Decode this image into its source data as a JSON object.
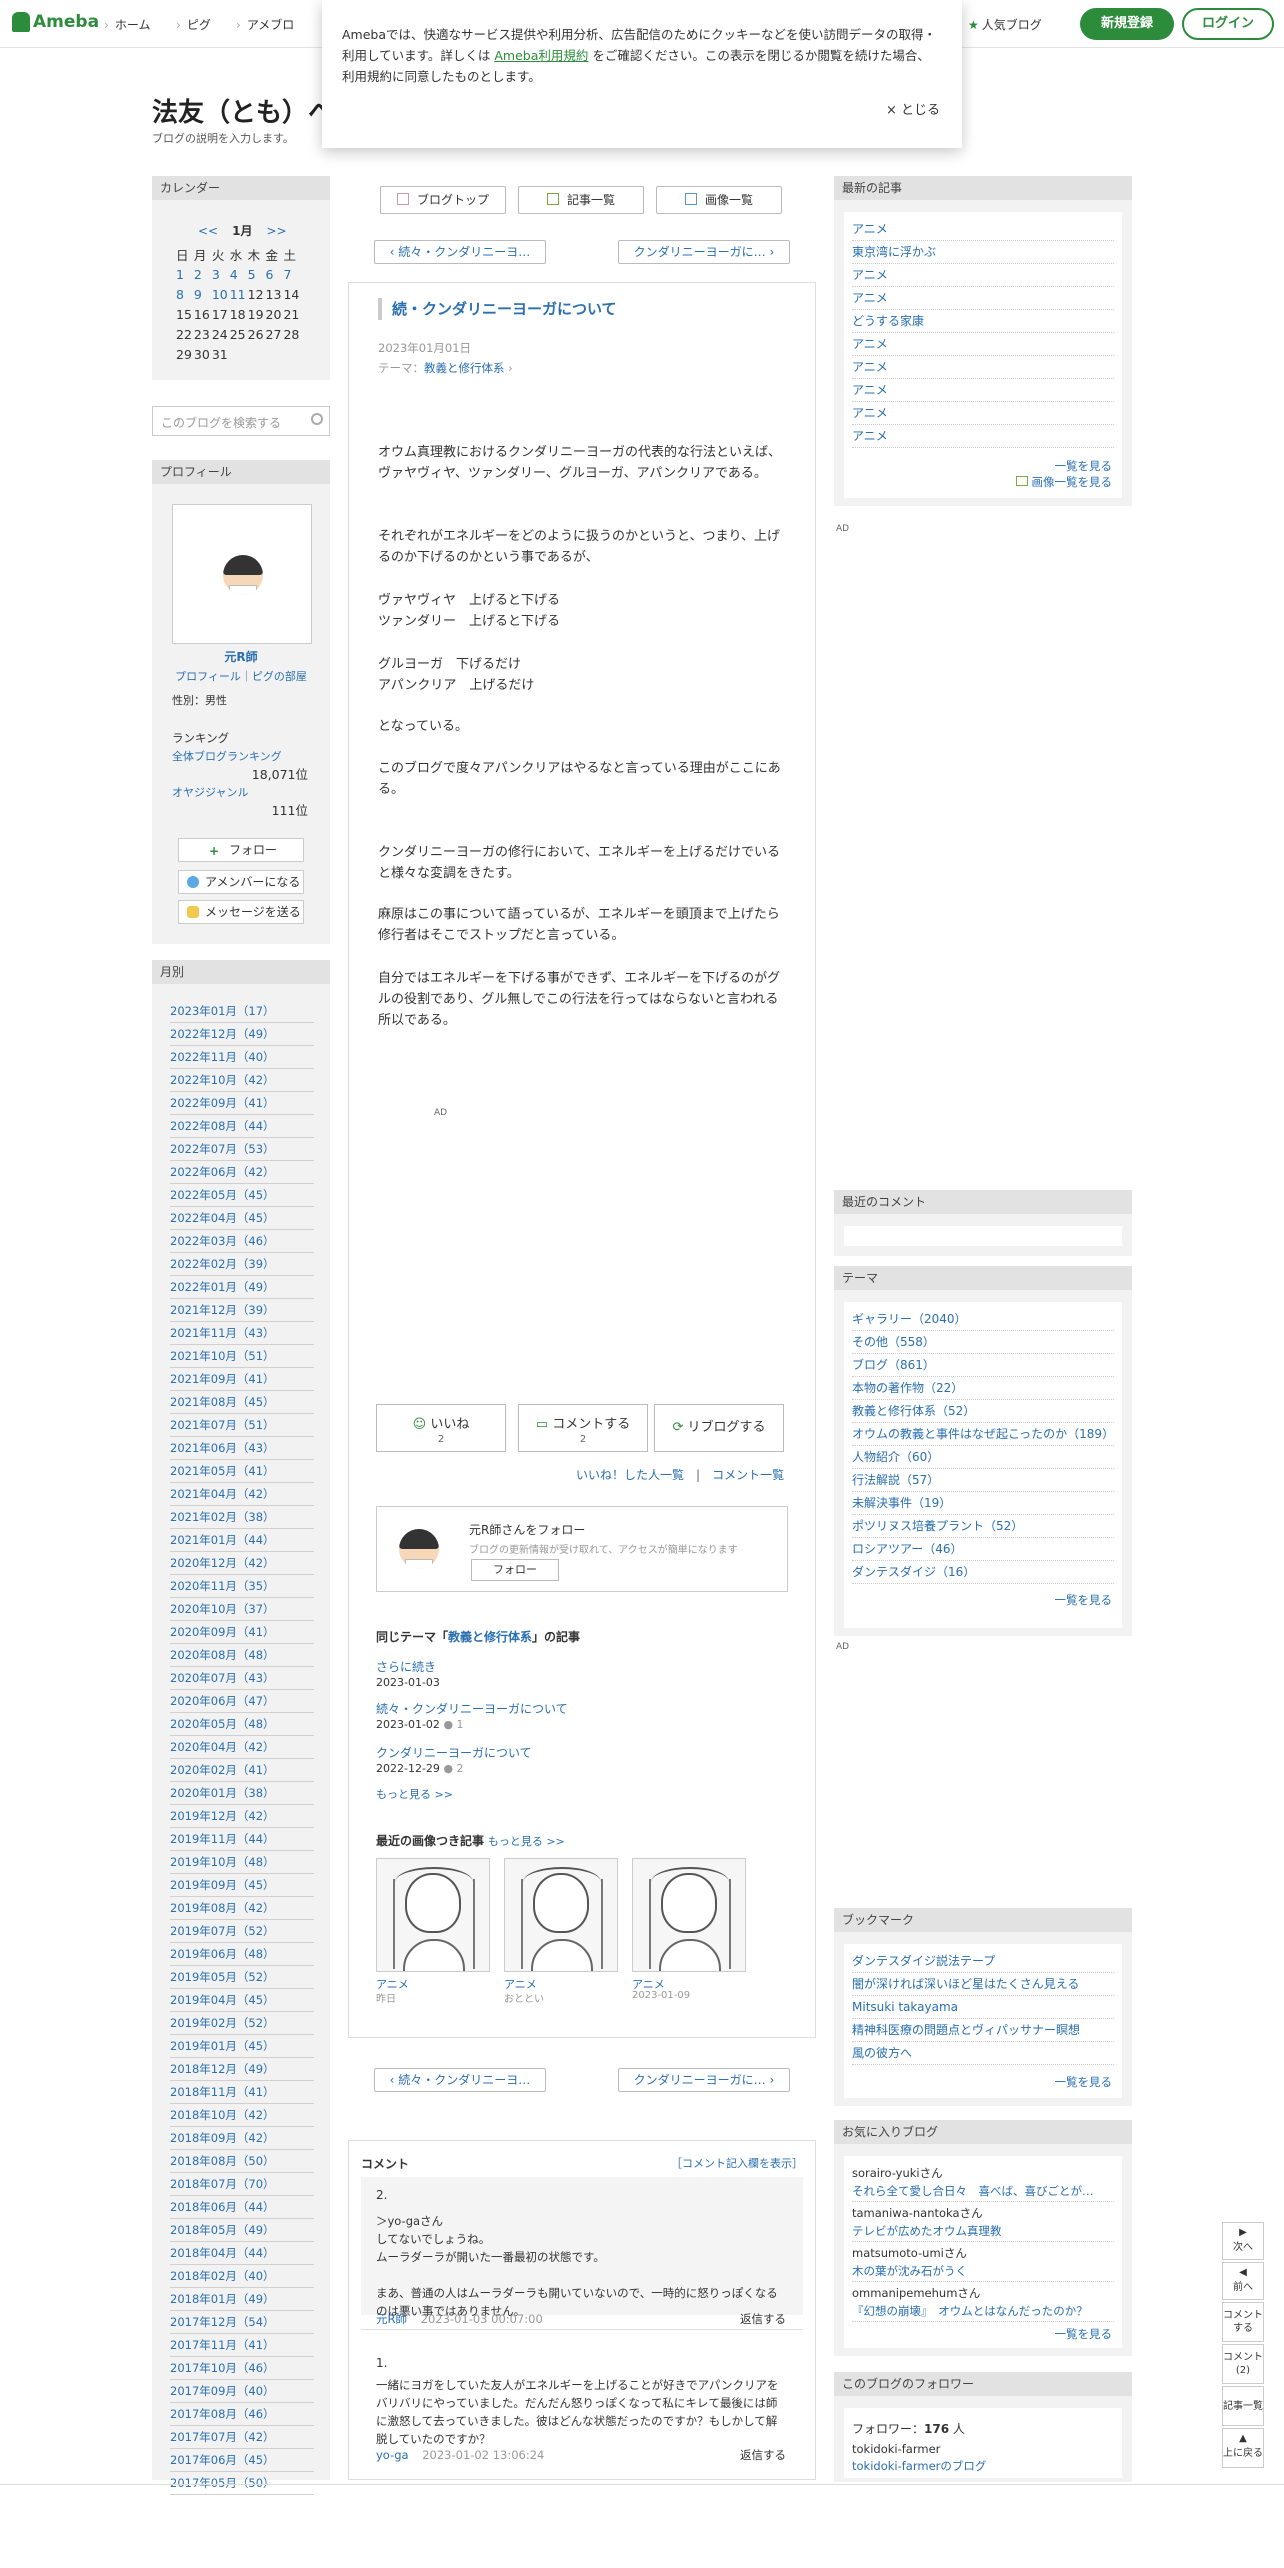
{
  "header": {
    "logo": "Ameba",
    "nav": [
      "ホーム",
      "ピグ",
      "アメブロ"
    ],
    "popular": "人気ブログ",
    "register": "新規登録",
    "login": "ログイン"
  },
  "cookie": {
    "text1": "Amebaでは、快適なサービス提供や利用分析、広告配信のためにクッキーなどを使い訪問データの取得・利用しています。詳しくは ",
    "link": "Ameba利用規約",
    "text2": " をご確認ください。この表示を閉じるか閲覧を続けた場合、利用規約に同意したものとします。",
    "close": "× とじる"
  },
  "blog": {
    "title": "法友（とも）へ",
    "desc": "ブログの説明を入力します。"
  },
  "calendar": {
    "heading": "カレンダー",
    "prev": "<<",
    "month": "1月",
    "next": ">>",
    "days": [
      "日",
      "月",
      "火",
      "水",
      "木",
      "金",
      "土"
    ],
    "weeks": [
      [
        "1",
        "2",
        "3",
        "4",
        "5",
        "6",
        "7"
      ],
      [
        "8",
        "9",
        "10",
        "11",
        "12",
        "13",
        "14"
      ],
      [
        "15",
        "16",
        "17",
        "18",
        "19",
        "20",
        "21"
      ],
      [
        "22",
        "23",
        "24",
        "25",
        "26",
        "27",
        "28"
      ],
      [
        "29",
        "30",
        "31",
        "",
        "",
        "",
        ""
      ]
    ]
  },
  "search": {
    "placeholder": "このブログを検索する"
  },
  "profile": {
    "heading": "プロフィール",
    "name": "元R師",
    "links": "プロフィール｜ピグの部屋",
    "gender": "性別：男性",
    "ranking": "ランキング",
    "overall": "全体ブログランキング",
    "overall_rank": "18,071位",
    "genre": "オヤジジャンル",
    "genre_rank": "111位",
    "follow": "フォロー",
    "member": "アメンバーになる",
    "message": "メッセージを送る"
  },
  "archive": {
    "heading": "月別",
    "items": [
      "2023年01月（17）",
      "2022年12月（49）",
      "2022年11月（40）",
      "2022年10月（42）",
      "2022年09月（41）",
      "2022年08月（44）",
      "2022年07月（53）",
      "2022年06月（42）",
      "2022年05月（45）",
      "2022年04月（45）",
      "2022年03月（46）",
      "2022年02月（39）",
      "2022年01月（49）",
      "2021年12月（39）",
      "2021年11月（43）",
      "2021年10月（51）",
      "2021年09月（41）",
      "2021年08月（45）",
      "2021年07月（51）",
      "2021年06月（43）",
      "2021年05月（41）",
      "2021年04月（42）",
      "2021年02月（38）",
      "2021年01月（44）",
      "2020年12月（42）",
      "2020年11月（35）",
      "2020年10月（37）",
      "2020年09月（41）",
      "2020年08月（48）",
      "2020年07月（43）",
      "2020年06月（47）",
      "2020年05月（48）",
      "2020年04月（42）",
      "2020年02月（41）",
      "2020年01月（38）",
      "2019年12月（42）",
      "2019年11月（44）",
      "2019年10月（48）",
      "2019年09月（45）",
      "2019年08月（42）",
      "2019年07月（52）",
      "2019年06月（48）",
      "2019年05月（52）",
      "2019年04月（45）",
      "2019年02月（52）",
      "2019年01月（45）",
      "2018年12月（49）",
      "2018年11月（41）",
      "2018年10月（42）",
      "2018年09月（42）",
      "2018年08月（50）",
      "2018年07月（70）",
      "2018年06月（44）",
      "2018年05月（49）",
      "2018年04月（44）",
      "2018年02月（40）",
      "2018年01月（49）",
      "2017年12月（54）",
      "2017年11月（41）",
      "2017年10月（46）",
      "2017年09月（40）",
      "2017年08月（46）",
      "2017年07月（42）",
      "2017年06月（45）",
      "2017年05月（50）"
    ]
  },
  "toolbar": {
    "top": "ブログトップ",
    "list": "記事一覧",
    "images": "画像一覧"
  },
  "pager": {
    "prev": "続々・クンダリニーヨ…",
    "next": "クンダリニーヨーガに…"
  },
  "entry": {
    "title": "続・クンダリニーヨーガについて",
    "date": "2023年01月01日",
    "theme_label": "テーマ：",
    "theme": "教義と修行体系",
    "p1": "オウム真理教におけるクンダリニーヨーガの代表的な行法といえば、ヴァヤヴィヤ、ツァンダリー、グルヨーガ、アパンクリアである。",
    "p2": "それぞれがエネルギーをどのように扱うのかというと、つまり、上げるのか下げるのかという事であるが、",
    "p3": "ヴァヤヴィヤ　上げると下げる\nツァンダリー　上げると下げる",
    "p4": "グルヨーガ　下げるだけ\nアパンクリア　上げるだけ",
    "p5": "となっている。",
    "p6": "このブログで度々アパンクリアはやるなと言っている理由がここにある。",
    "p7": "クンダリニーヨーガの修行において、エネルギーを上げるだけでいると様々な変調をきたす。",
    "p8": "麻原はこの事について語っているが、エネルギーを頭頂まで上げたら修行者はそこでストップだと言っている。",
    "p9": "自分ではエネルギーを下げる事ができず、エネルギーを下げるのがグルの役割であり、グル無しでこの行法を行ってはならないと言われる所以である。",
    "ad": "AD"
  },
  "actions": {
    "like": "いいね",
    "like_count": "2",
    "comment": "コメントする",
    "comment_count": "2",
    "reblog": "リブログする",
    "liked_people": "いいね！した人一覧",
    "comment_list": "コメント一覧"
  },
  "followbox": {
    "text": "元R師さんをフォロー",
    "sub": "ブログの更新情報が受け取れて、アクセスが簡単になります",
    "button": "フォロー"
  },
  "related": {
    "heading_pre": "同じテーマ「",
    "theme": "教義と修行体系",
    "heading_post": "」の記事",
    "items": [
      {
        "title": "さらに続き",
        "date": "2023-01-03",
        "count": ""
      },
      {
        "title": "続々・クンダリニーヨーガについて",
        "date": "2023-01-02",
        "count": "1"
      },
      {
        "title": "クンダリニーヨーガについて",
        "date": "2022-12-29",
        "count": "2"
      }
    ],
    "more": "もっと見る >>"
  },
  "images": {
    "heading": "最近の画像つき記事",
    "more": "もっと見る >>",
    "items": [
      {
        "label": "アニメ",
        "date": "昨日"
      },
      {
        "label": "アニメ",
        "date": "おととい"
      },
      {
        "label": "アニメ",
        "date": "2023-01-09"
      }
    ]
  },
  "comments": {
    "heading": "コメント",
    "toggle": "［コメント記入欄を表示］",
    "c2": {
      "num": "2.",
      "text": "＞yo-gaさん\nしてないでしょうね。\nムーラダーラが開いた一番最初の状態です。\n\nまあ、普通の人はムーラダーラも開いていないので、一時的に怒りっぽくなるのは悪い事ではありません。",
      "author": "元R師",
      "date": "2023-01-03 00:07:00",
      "reply": "返信する"
    },
    "c1": {
      "num": "1.",
      "text": "一緒にヨガをしていた友人がエネルギーを上げることが好きでアパンクリアをバリバリにやっていました。だんだん怒りっぽくなって私にキレて最後には師に激怒して去っていきました。彼はどんな状態だったのですか？もしかして解脱していたのですか？",
      "author": "yo-ga",
      "date": "2023-01-02 13:06:24",
      "reply": "返信する"
    }
  },
  "recent": {
    "heading": "最新の記事",
    "items": [
      "アニメ",
      "東京湾に浮かぶ",
      "アニメ",
      "アニメ",
      "どうする家康",
      "アニメ",
      "アニメ",
      "アニメ",
      "アニメ",
      "アニメ"
    ],
    "more": "一覧を見る",
    "images": "画像一覧を見る"
  },
  "recent_comments": {
    "heading": "最近のコメント"
  },
  "themes": {
    "heading": "テーマ",
    "items": [
      "ギャラリー（2040）",
      "その他（558）",
      "ブログ（861）",
      "本物の著作物（22）",
      "教義と修行体系（52）",
      "オウムの教義と事件はなぜ起こったのか（189）",
      "人物紹介（60）",
      "行法解説（57）",
      "未解決事件（19）",
      "ポツリヌス培養プラント（52）",
      "ロシアツアー（46）",
      "ダンテスダイジ（16）"
    ],
    "more": "一覧を見る"
  },
  "bookmarks": {
    "heading": "ブックマーク",
    "items": [
      "ダンテスダイジ説法テープ",
      "闇が深ければ深いほど星はたくさん見える",
      "Mitsuki takayama",
      "精神科医療の問題点とヴィパッサナー瞑想",
      "風の彼方へ"
    ],
    "more": "一覧を見る"
  },
  "fav_reblog": {
    "heading": "お気に入りブログ",
    "items": [
      {
        "user": "sorairo-yuki",
        "blog": "それら全て愛し合日々　喜べば、喜びごとが…"
      },
      {
        "user": "tamaniwa-nantoka",
        "blog": "テレビが広めたオウム真理教"
      },
      {
        "user": "matsumoto-umi",
        "blog": "木の葉が沈み石がうく"
      },
      {
        "user": "ommanipemehum",
        "blog": "『幻想の崩壊』　オウムとはなんだったのか？"
      }
    ],
    "san": "さん",
    "more": "一覧を見る"
  },
  "followers": {
    "heading": "このブログのフォロワー",
    "label": "フォロワー：",
    "count": "176",
    "unit": "人",
    "user": "tokidoki-farmer",
    "blog": "tokidoki-farmerのブログ"
  },
  "fixnav": {
    "next": "次へ",
    "prev": "前へ",
    "comment": "コメントする",
    "comments": "コメント(2)",
    "list": "記事一覧",
    "top": "上に戻る"
  },
  "colors": {
    "brand": "#2d8c3c",
    "link": "#2a6fb0"
  }
}
